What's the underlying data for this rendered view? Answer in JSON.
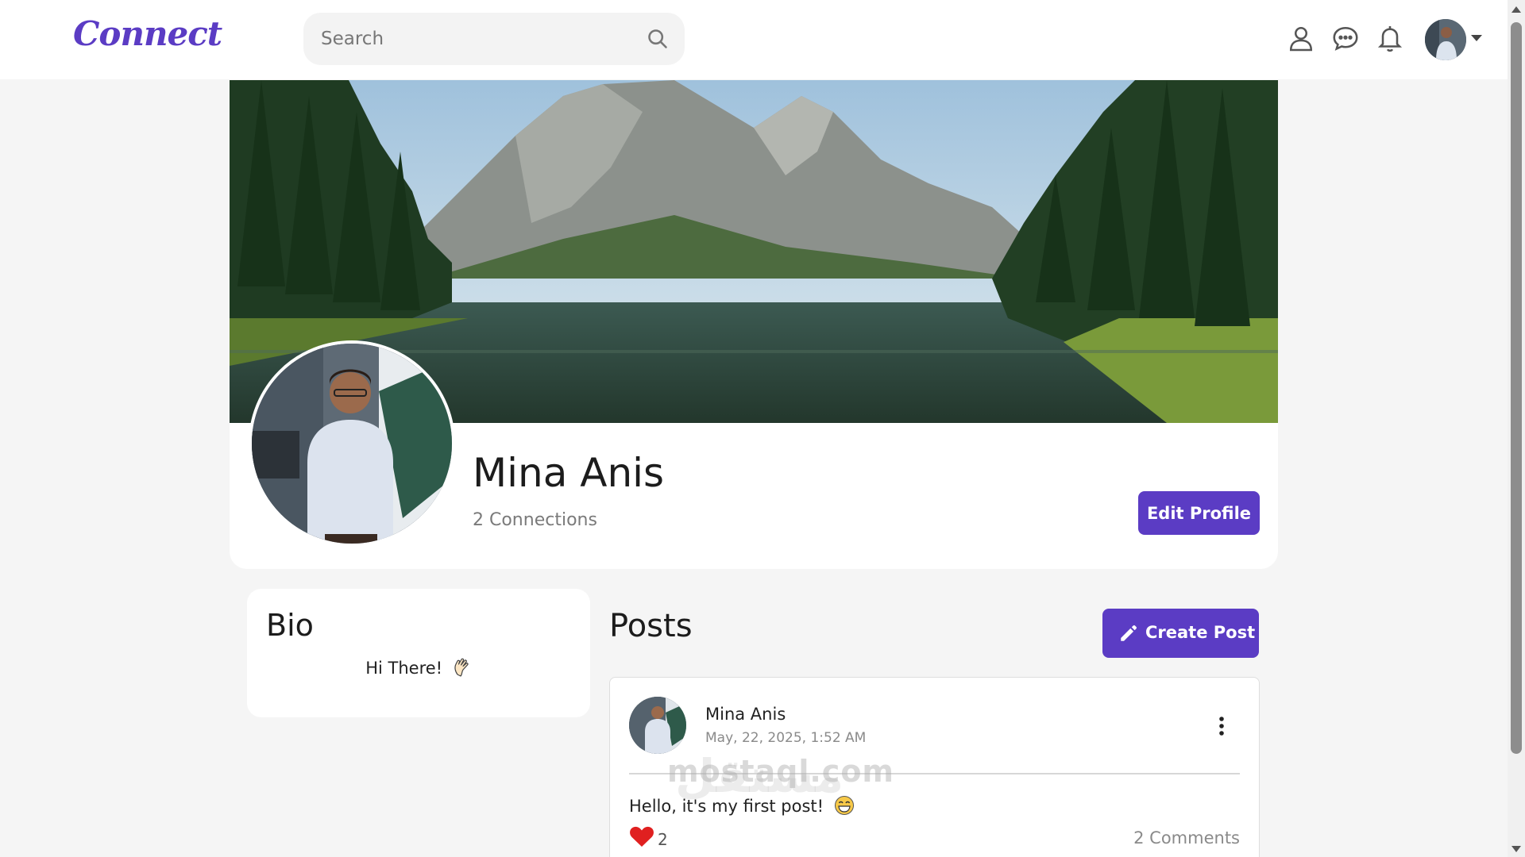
{
  "app": {
    "logo": "Connect"
  },
  "header": {
    "search": {
      "placeholder": "Search",
      "value": ""
    }
  },
  "profile": {
    "name": "Mina Anis",
    "connections": "2 Connections",
    "edit_label": "Edit Profile"
  },
  "bio": {
    "title": "Bio",
    "text": "Hi There!"
  },
  "posts": {
    "title": "Posts",
    "create_label": "Create Post",
    "items": [
      {
        "author": "Mina Anis",
        "date": "May, 22, 2025, 1:52 AM",
        "text": "Hello, it's my first post!",
        "likes": "2",
        "comments": "2 Comments"
      }
    ]
  },
  "watermark": {
    "latin": "mostaql.com",
    "arabic": "مستقل"
  },
  "colors": {
    "accent": "#5b3cc4",
    "like": "#e02020",
    "background": "#f5f5f5"
  },
  "icons": [
    "search-icon",
    "user-icon",
    "chat-icon",
    "bell-icon",
    "caret-down-icon",
    "pencil-icon",
    "kebab-menu-icon",
    "heart-icon",
    "wave-emoji",
    "grin-emoji"
  ]
}
